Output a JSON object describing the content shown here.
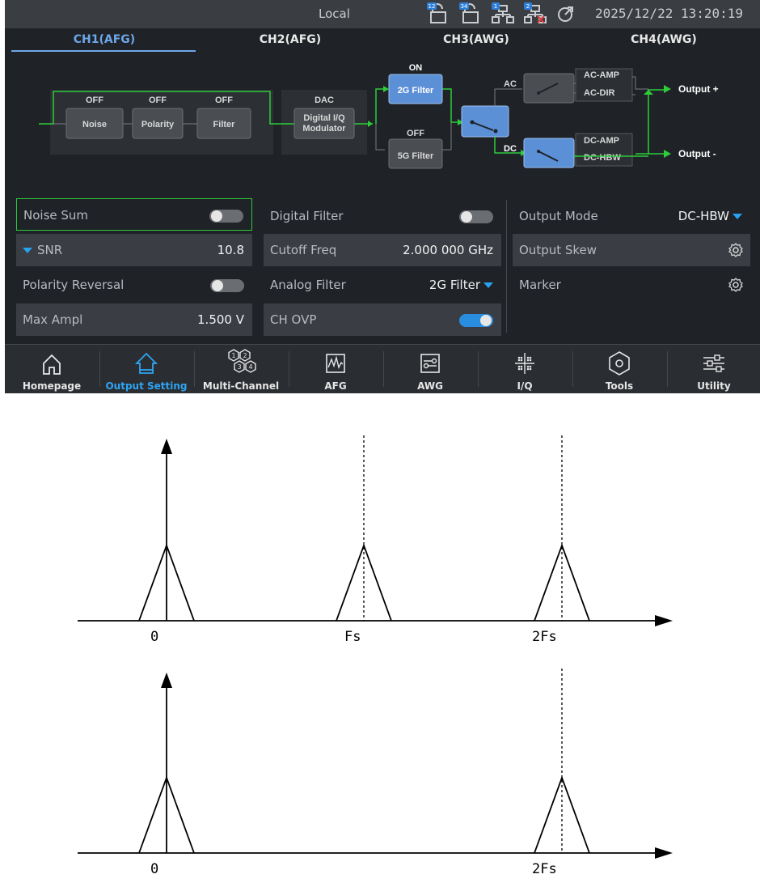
{
  "status": {
    "mode": "Local",
    "datetime": "2025/12/22 13:20:19",
    "badges": [
      "12",
      "34",
      "1",
      "2"
    ]
  },
  "tabs": [
    {
      "label": "CH1(AFG)",
      "active": true
    },
    {
      "label": "CH2(AFG)",
      "active": false
    },
    {
      "label": "CH3(AWG)",
      "active": false
    },
    {
      "label": "CH4(AWG)",
      "active": false
    }
  ],
  "diagram": {
    "blocks": [
      {
        "state": "OFF",
        "label": "Noise"
      },
      {
        "state": "OFF",
        "label": "Polarity"
      },
      {
        "state": "OFF",
        "label": "Filter"
      },
      {
        "state": "DAC",
        "label1": "Digital I/Q",
        "label2": "Modulator"
      },
      {
        "state": "ON",
        "label": "2G Filter"
      },
      {
        "state": "OFF",
        "label": "5G Filter"
      }
    ],
    "ac": "AC",
    "dc": "DC",
    "ac_amp": "AC-AMP",
    "ac_dir": "AC-DIR",
    "dc_amp": "DC-AMP",
    "dc_hbw": "DC-HBW",
    "out_pos": "Output +",
    "out_neg": "Output -"
  },
  "settings": {
    "col1": [
      {
        "label": "Noise Sum",
        "toggle": "off"
      },
      {
        "label": "SNR",
        "value": "10.8"
      },
      {
        "label": "Polarity Reversal",
        "toggle": "off"
      },
      {
        "label": "Max Ampl",
        "value": "1.500 V"
      }
    ],
    "col2": [
      {
        "label": "Digital Filter",
        "toggle": "off"
      },
      {
        "label": "Cutoff Freq",
        "value": "2.000 000 GHz"
      },
      {
        "label": "Analog Filter",
        "value": "2G Filter"
      },
      {
        "label": "CH OVP",
        "toggle": "on"
      }
    ],
    "col3": [
      {
        "label": "Output Mode",
        "value": "DC-HBW"
      },
      {
        "label": "Output Skew",
        "icon": "gear-icon"
      },
      {
        "label": "Marker",
        "icon": "gear-icon"
      }
    ]
  },
  "nav": [
    {
      "label": "Homepage",
      "icon": "home-icon"
    },
    {
      "label": "Output Setting",
      "icon": "output-setting-icon",
      "active": true
    },
    {
      "label": "Multi-Channel",
      "icon": "multi-channel-icon",
      "digits": [
        "1",
        "2",
        "3",
        "4"
      ]
    },
    {
      "label": "AFG",
      "icon": "afg-icon"
    },
    {
      "label": "AWG",
      "icon": "awg-icon"
    },
    {
      "label": "I/Q",
      "icon": "iq-icon"
    },
    {
      "label": "Tools",
      "icon": "tools-icon"
    },
    {
      "label": "Utility",
      "icon": "utility-icon"
    }
  ],
  "spectra": {
    "top_labels": [
      "0",
      "Fs",
      "2Fs"
    ],
    "bottom_labels": [
      "0",
      "2Fs"
    ]
  },
  "colors": {
    "accent": "#2fa4f2",
    "signal": "#2dcc3a",
    "block_on": "#5b8fd6",
    "panel": "#1f2227"
  }
}
